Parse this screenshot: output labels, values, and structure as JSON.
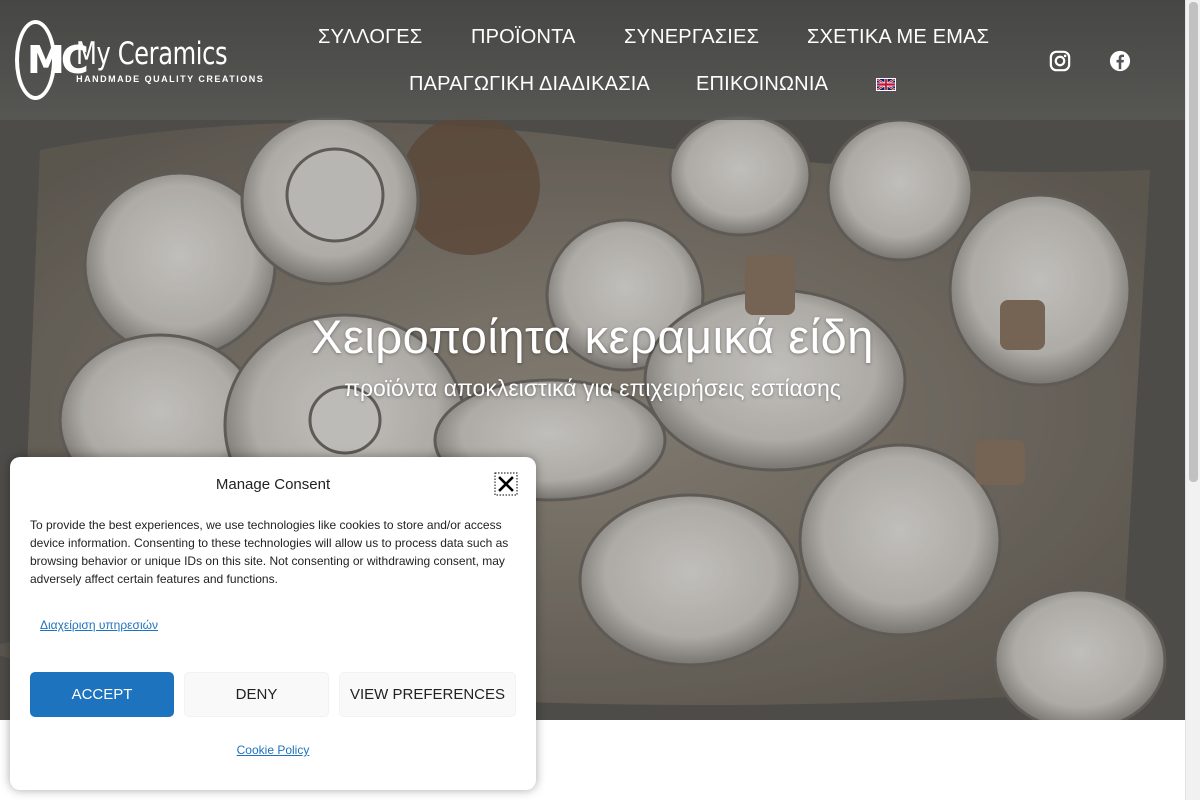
{
  "header": {
    "logo": {
      "brand": "My Ceramics",
      "tagline": "HANDMADE QUALITY CREATIONS",
      "mark": "MC"
    },
    "nav": [
      {
        "label": "ΣΥΛΛΟΓΕΣ"
      },
      {
        "label": "ΠΡΟΪΟΝΤΑ"
      },
      {
        "label": "ΣΥΝΕΡΓΑΣΙΕΣ"
      },
      {
        "label": "ΣΧΕΤΙΚΑ ΜΕ ΕΜΑΣ"
      },
      {
        "label": "ΠΑΡΑΓΩΓΙΚΗ ΔΙΑΔΙΚΑΣΙΑ"
      },
      {
        "label": "ΕΠΙΚΟΙΝΩΝΙΑ"
      }
    ],
    "language_icon": "uk-flag-icon",
    "social": [
      "instagram-icon",
      "facebook-icon"
    ]
  },
  "hero": {
    "title": "Χειροποίητα κεραμικά είδη",
    "subtitle": "προϊόντα αποκλειστικά για επιχειρήσεις εστίασης"
  },
  "consent": {
    "title": "Manage Consent",
    "body": "To provide the best experiences, we use technologies like cookies to store and/or access device information. Consenting to these technologies will allow us to process data such as browsing behavior or unique IDs on this site. Not consenting or withdrawing consent, may adversely affect certain features and functions.",
    "manage_link": "Διαχείριση υπηρεσιών",
    "accept_label": "ACCEPT",
    "deny_label": "DENY",
    "preferences_label": "VIEW PREFERENCES",
    "policy_link": "Cookie Policy",
    "accent_color": "#1e73be"
  }
}
